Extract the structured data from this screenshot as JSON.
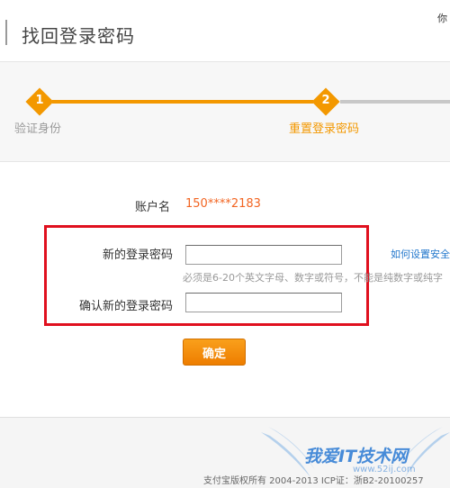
{
  "header": {
    "title": "找回登录密码",
    "right_text": "你"
  },
  "steps": [
    {
      "number": "1",
      "label": "验证身份",
      "state": "done"
    },
    {
      "number": "2",
      "label": "重置登录密码",
      "state": "current"
    }
  ],
  "form": {
    "account_label": "账户名",
    "account_value": "150****2183",
    "new_password_label": "新的登录密码",
    "new_password_value": "",
    "confirm_password_label": "确认新的登录密码",
    "confirm_password_value": "",
    "hint": "必须是6-20个英文字母、数字或符号，不能是纯数字或纯字",
    "help_link": "如何设置安全",
    "submit_label": "确定"
  },
  "footer": {
    "copyright": "支付宝版权所有 2004-2013 ICP证：浙B2-20100257"
  },
  "watermark": {
    "text": "我爱IT技术网",
    "url": "www.52ij.com"
  },
  "colors": {
    "accent": "#f39800",
    "highlight_box": "#e0101e",
    "account_value": "#f26522",
    "link": "#2277cc"
  }
}
